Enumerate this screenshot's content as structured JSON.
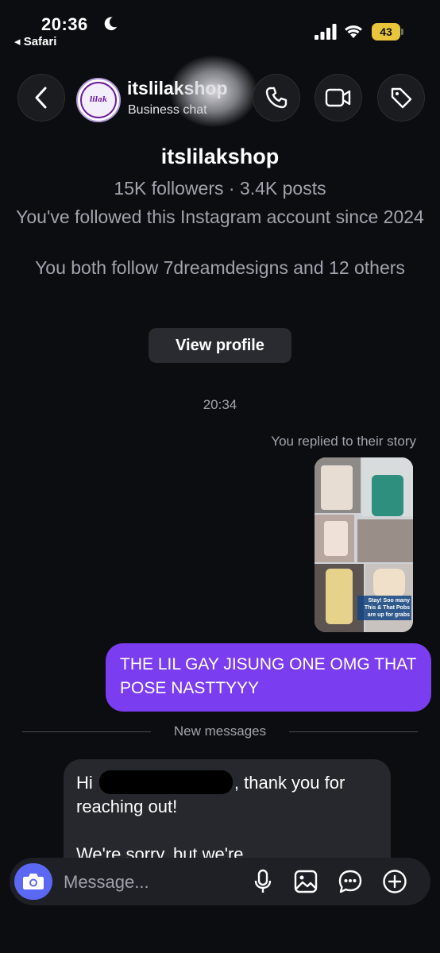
{
  "status_bar": {
    "time": "20:36",
    "back_app": "◂ Safari",
    "battery": "43"
  },
  "header": {
    "name": "itslilakshop",
    "subtitle": "Business chat",
    "avatar_text": "lilak"
  },
  "profile": {
    "name": "itslilakshop",
    "stats": "15K followers · 3.4K posts",
    "follow_since": "You've followed this Instagram account since 2024",
    "mutual": "You both follow 7dreamdesigns and 12 others",
    "view_profile": "View profile"
  },
  "thread": {
    "timestamp": "20:34",
    "reply_note": "You replied to their story",
    "story_caption": "Stay! Soo many This & That Pobs are up for grabs",
    "sent_message": "THE LIL GAY JISUNG ONE OMG THAT POSE NASTTYYY",
    "new_messages_label": "New messages",
    "received_before": "Hi",
    "received_after": ", thank you for reaching out!",
    "received_cutoff": "We're sorry, but we're"
  },
  "composer": {
    "placeholder": "Message..."
  },
  "colors": {
    "background": "#0c0d10",
    "sent_bubble": "#7b3df0",
    "received_bubble": "#26282d",
    "camera_button": "#5a68f4",
    "battery": "#e8c53a"
  },
  "icons": [
    "moon-icon",
    "signal-icon",
    "wifi-icon",
    "back-chevron-icon",
    "phone-icon",
    "video-camera-icon",
    "tag-icon",
    "camera-icon",
    "mic-icon",
    "gallery-icon",
    "sticker-icon",
    "plus-circle-icon"
  ]
}
